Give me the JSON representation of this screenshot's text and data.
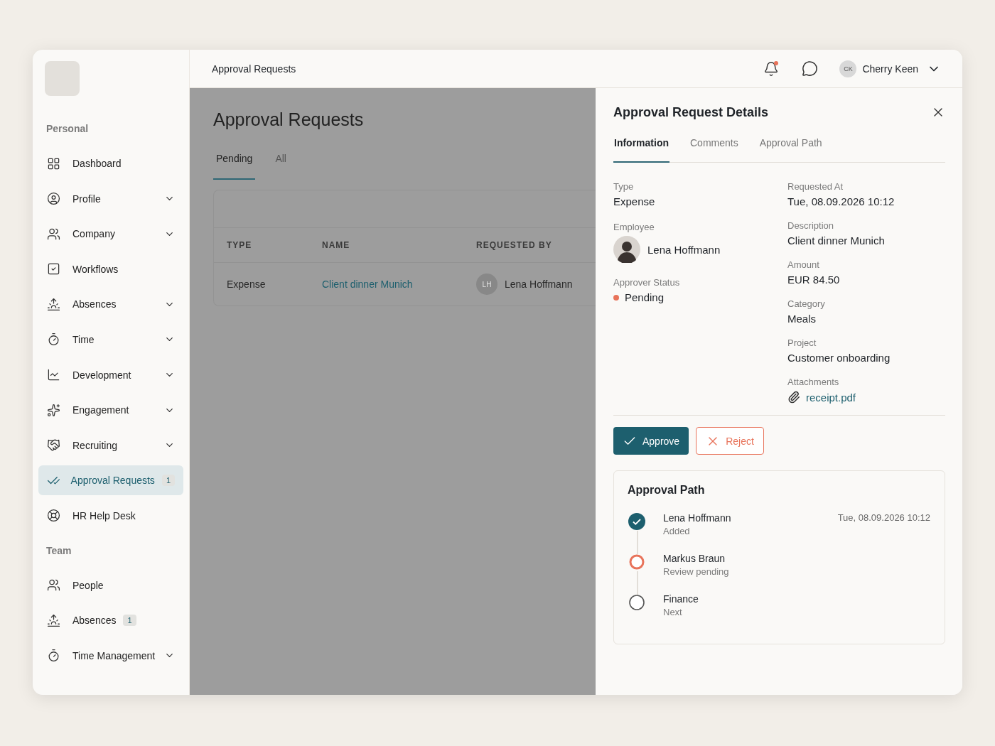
{
  "topbar": {
    "title": "Approval Requests",
    "notifications_unread": true,
    "user": {
      "initials": "CK",
      "name": "Cherry Keen"
    }
  },
  "sidebar": {
    "sections": [
      {
        "heading": "Personal",
        "items": [
          {
            "label": "Dashboard",
            "selected": false,
            "submenu": false
          },
          {
            "label": "Profile",
            "selected": false,
            "submenu": true
          },
          {
            "label": "Company",
            "selected": false,
            "submenu": true
          },
          {
            "label": "Workflows",
            "selected": false,
            "submenu": false
          },
          {
            "label": "Absences",
            "selected": false,
            "submenu": true
          },
          {
            "label": "Time",
            "selected": false,
            "submenu": true
          },
          {
            "label": "Development",
            "selected": false,
            "submenu": true
          },
          {
            "label": "Engagement",
            "selected": false,
            "submenu": true
          },
          {
            "label": "Recruiting",
            "selected": false,
            "submenu": true
          },
          {
            "label": "Approval Requests",
            "selected": true,
            "submenu": false,
            "badge": "1"
          },
          {
            "label": "HR Help Desk",
            "selected": false,
            "submenu": false
          }
        ]
      },
      {
        "heading": "Team",
        "items": [
          {
            "label": "People",
            "selected": false,
            "submenu": false
          },
          {
            "label": "Absences",
            "selected": false,
            "submenu": false,
            "badge": "1"
          },
          {
            "label": "Time Management",
            "selected": false,
            "submenu": true
          }
        ]
      }
    ]
  },
  "main": {
    "heading": "Approval Requests",
    "tabs": [
      {
        "label": "Pending",
        "selected": true
      },
      {
        "label": "All",
        "selected": false
      }
    ],
    "table": {
      "columns": [
        "TYPE",
        "NAME",
        "REQUESTED BY"
      ],
      "rows": [
        {
          "type": "Expense",
          "name": "Client dinner Munich",
          "requester_initials": "LH",
          "requester": "Lena Hoffmann"
        }
      ]
    }
  },
  "drawer": {
    "title": "Approval Request Details",
    "tabs": [
      {
        "label": "Information",
        "selected": true
      },
      {
        "label": "Comments",
        "selected": false
      },
      {
        "label": "Approval Path",
        "selected": false
      }
    ],
    "left_fields": [
      {
        "kind": "text",
        "label": "Type",
        "value": "Expense"
      },
      {
        "kind": "person",
        "label": "Employee",
        "value": "Lena Hoffmann"
      },
      {
        "kind": "status",
        "label": "Approver Status",
        "value": "Pending",
        "color": "#e8735a"
      }
    ],
    "right_fields": [
      {
        "kind": "text",
        "label": "Requested At",
        "value": "Tue, 08.09.2026 10:12"
      },
      {
        "kind": "text",
        "label": "Description",
        "value": "Client dinner Munich"
      },
      {
        "kind": "text",
        "label": "Amount",
        "value": "EUR 84.50"
      },
      {
        "kind": "text",
        "label": "Category",
        "value": "Meals"
      },
      {
        "kind": "text",
        "label": "Project",
        "value": "Customer onboarding"
      },
      {
        "kind": "attachment",
        "label": "Attachments",
        "value": "receipt.pdf"
      }
    ],
    "approve": "Approve",
    "reject": "Reject",
    "path": {
      "title": "Approval Path",
      "steps": [
        {
          "kind": "done",
          "name": "Lena Hoffmann",
          "note": "Added",
          "time": "Tue, 08.09.2026 10:12"
        },
        {
          "kind": "current",
          "name": "Markus Braun",
          "note": "Review pending"
        },
        {
          "kind": "upcoming",
          "name": "Finance",
          "note": "Next"
        }
      ]
    }
  }
}
